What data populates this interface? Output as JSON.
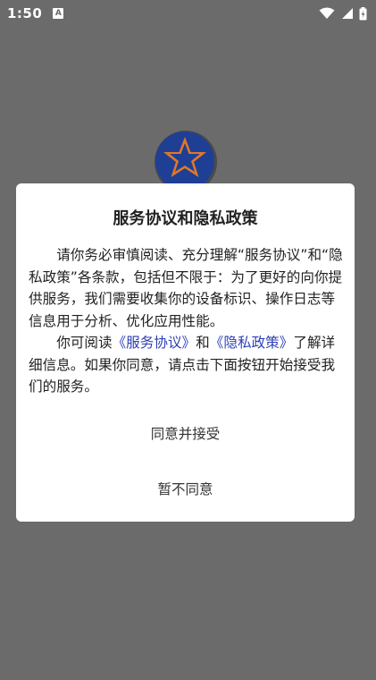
{
  "status_bar": {
    "time": "1:50",
    "notification_icon": "A"
  },
  "dialog": {
    "title": "服务协议和隐私政策",
    "paragraph1": "请你务必审慎阅读、充分理解“服务协议”和“隐私政策”各条款，包括但不限于：为了更好的向你提供服务，我们需要收集你的设备标识、操作日志等信息用于分析、优化应用性能。",
    "paragraph2_prefix": "你可阅读",
    "service_agreement_link": "《服务协议》",
    "paragraph2_and": "和",
    "privacy_policy_link": "《隐私政策》",
    "paragraph2_suffix": "了解详细信息。如果你同意，请点击下面按钮开始接受我们的服务。",
    "accept_label": "同意并接受",
    "decline_label": "暂不同意"
  },
  "colors": {
    "overlay": "#6b6b6b",
    "link": "#2c3fb5",
    "logo_blue": "#1f3f94",
    "logo_orange": "#e0782a"
  },
  "icons": [
    "notification-a-icon",
    "wifi-icon",
    "signal-icon",
    "battery-icon",
    "app-logo-star-icon"
  ]
}
